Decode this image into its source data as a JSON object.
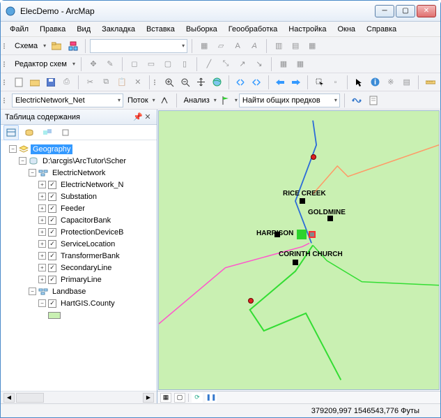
{
  "window": {
    "title": "ElecDemo - ArcMap"
  },
  "menu": [
    "Файл",
    "Правка",
    "Вид",
    "Закладка",
    "Вставка",
    "Выборка",
    "Геообработка",
    "Настройка",
    "Окна",
    "Справка"
  ],
  "toolbar_schema": {
    "label": "Схема"
  },
  "toolbar_editor": {
    "label": "Редактор схем"
  },
  "network_row": {
    "dropdown": "ElectricNetwork_Net",
    "flow_label": "Поток",
    "analysis_label": "Анализ",
    "task_dropdown": "Найти общих предков"
  },
  "toc": {
    "title": "Таблица содержания",
    "root": "Geography",
    "dataframe": "D:\\arcgis\\ArcTutor\\Scher",
    "group_elec": "ElectricNetwork",
    "layers_elec": [
      "ElectricNetwork_N",
      "Substation",
      "Feeder",
      "CapacitorBank",
      "ProtectionDeviceB",
      "ServiceLocation",
      "TransformerBank",
      "SecondaryLine",
      "PrimaryLine"
    ],
    "group_land": "Landbase",
    "layer_land": "HartGIS.County"
  },
  "map_labels": {
    "rice": "RICE CREEK",
    "gold": "GOLDMINE",
    "harr": "HARRISON",
    "corinth": "CORINTH CHURCH"
  },
  "status": {
    "coords": "379209,997 1546543,776 Футы"
  }
}
